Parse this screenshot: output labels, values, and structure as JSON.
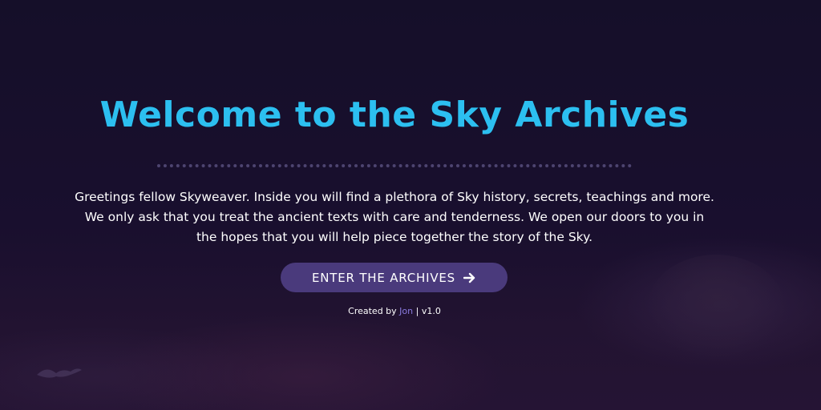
{
  "hero": {
    "title": "Welcome to the Sky Archives",
    "description": "Greetings fellow Skyweaver. Inside you will find a plethora of Sky history, secrets, teachings and more. We only ask that you treat the ancient texts with care and tenderness. We open our doors to you in the hopes that you will help piece together the story of the Sky."
  },
  "cta": {
    "label": "ENTER THE ARCHIVES",
    "icon": "arrow-right-icon"
  },
  "footer": {
    "created_by": "Created by",
    "author": "Jon",
    "separator": "|",
    "version": "v1.0"
  },
  "colors": {
    "background": "#170f2c",
    "title": "#2cbff0",
    "button": "#4a3a7c",
    "author_link": "#8a7be0",
    "divider": "#4d4470"
  }
}
